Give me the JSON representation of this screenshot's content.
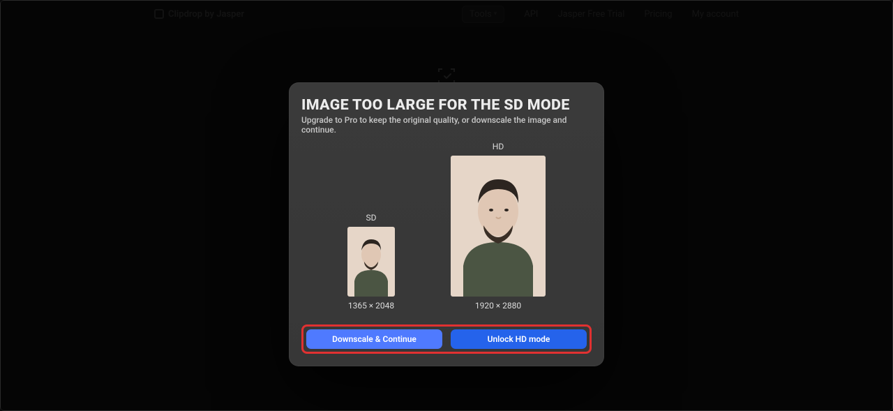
{
  "nav": {
    "brand": "Clipdrop by Jasper",
    "items": {
      "tools": "Tools",
      "api": "API",
      "trial": "Jasper Free Trial",
      "pricing": "Pricing",
      "account": "My account"
    }
  },
  "modal": {
    "title": "IMAGE TOO LARGE FOR THE SD MODE",
    "subtitle": "Upgrade to Pro to keep the original quality, or downscale the image and continue.",
    "sd": {
      "label": "SD",
      "dimensions": "1365 × 2048"
    },
    "hd": {
      "label": "HD",
      "dimensions": "1920 × 2880"
    },
    "buttons": {
      "downscale": "Downscale & Continue",
      "unlock": "Unlock HD mode"
    }
  },
  "colors": {
    "highlight": "#e03131",
    "blue": "#2563eb",
    "blue_light": "#4f7aff"
  }
}
